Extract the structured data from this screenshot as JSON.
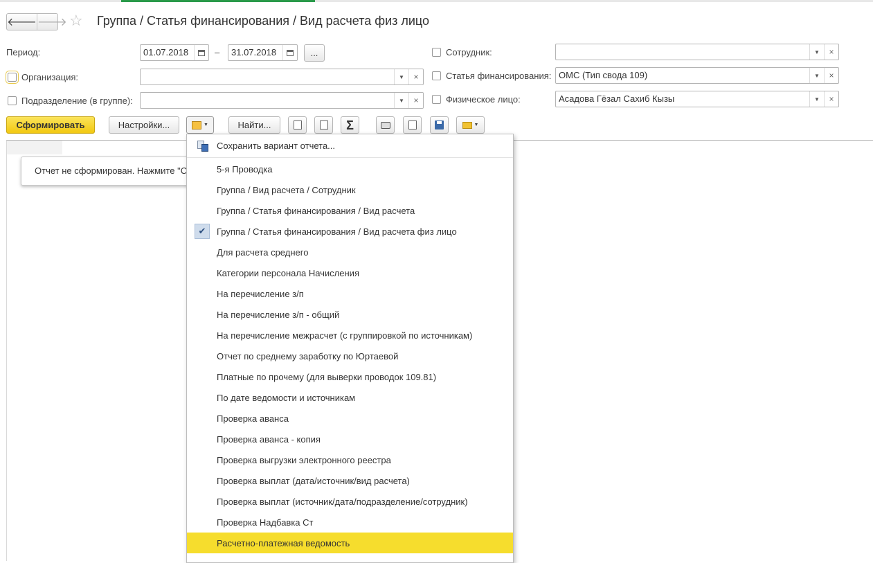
{
  "header": {
    "title": "Группа / Статья финансирования / Вид расчета физ лицо",
    "back_glyph": "🡐",
    "forward_glyph": "🡒",
    "star_glyph": "☆"
  },
  "filters": {
    "period_label": "Период:",
    "period_from": "01.07.2018",
    "period_dash": "–",
    "period_to": "31.07.2018",
    "period_more": "...",
    "organization_label": "Организация:",
    "organization_value": "",
    "subdivision_label": "Подразделение (в группе):",
    "subdivision_value": "",
    "employee_label": "Сотрудник:",
    "employee_value": "",
    "funding_label": "Статья финансирования:",
    "funding_value": "ОМС (Тип свода 109)",
    "person_label": "Физическое лицо:",
    "person_value": "Асадова Гёзал Сахиб Кызы"
  },
  "toolbar": {
    "generate_label": "Сформировать",
    "settings_label": "Настройки...",
    "find_label": "Найти...",
    "sigma_glyph": "Σ"
  },
  "report": {
    "notice": "Отчет не сформирован. Нажмите \"Сформировать\""
  },
  "menu": {
    "save_variant": "Сохранить вариант отчета...",
    "check_glyph": "✔",
    "items": [
      {
        "label": "5-я Проводка"
      },
      {
        "label": "Группа / Вид расчета / Сотрудник"
      },
      {
        "label": "Группа / Статья финансирования / Вид расчета"
      },
      {
        "label": "Группа / Статья финансирования / Вид расчета физ лицо",
        "checked": true
      },
      {
        "label": "Для расчета среднего"
      },
      {
        "label": "Категории персонала Начисления"
      },
      {
        "label": "На перечисление з/п"
      },
      {
        "label": "На перечисление з/п - общий"
      },
      {
        "label": "На перечисление межрасчет (с группировкой по источникам)"
      },
      {
        "label": "Отчет по среднему заработку по Юртаевой"
      },
      {
        "label": "Платные по прочему (для выверки проводок 109.81)"
      },
      {
        "label": "По дате ведомости и источникам"
      },
      {
        "label": "Проверка аванса"
      },
      {
        "label": "Проверка аванса - копия"
      },
      {
        "label": "Проверка выгрузки электронного реестра"
      },
      {
        "label": "Проверка выплат (дата/источник/вид расчета)"
      },
      {
        "label": "Проверка выплат (источник/дата/подразделение/сотрудник)"
      },
      {
        "label": "Проверка Надбавка Ст"
      },
      {
        "label": "Расчетно-платежная ведомость",
        "highlighted": true
      }
    ]
  }
}
